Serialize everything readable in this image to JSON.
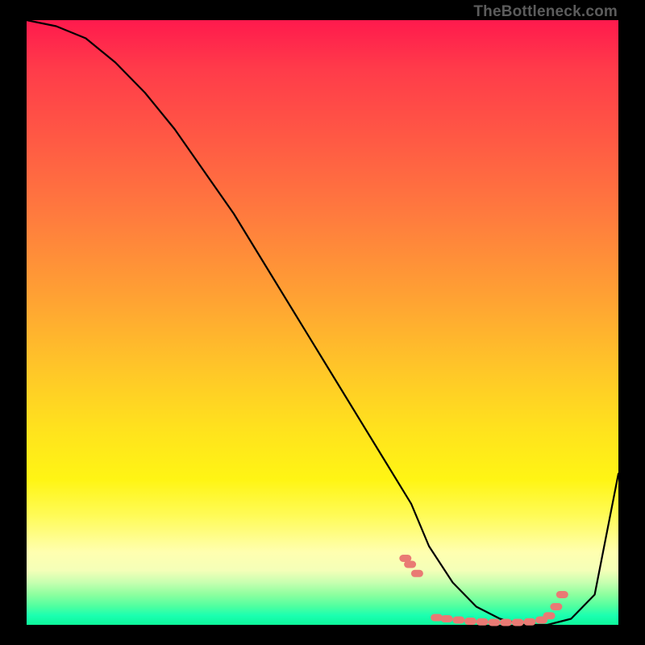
{
  "watermark": {
    "text": "TheBottleneck.com"
  },
  "chart_data": {
    "type": "line",
    "title": "",
    "xlabel": "",
    "ylabel": "",
    "xlim": [
      0,
      100
    ],
    "ylim": [
      0,
      100
    ],
    "background": "rainbow-vertical-gradient",
    "series": [
      {
        "name": "bottleneck-curve",
        "stroke": "#000000",
        "x": [
          0,
          5,
          10,
          15,
          20,
          25,
          30,
          35,
          40,
          45,
          50,
          55,
          60,
          65,
          68,
          72,
          76,
          80,
          84,
          88,
          92,
          96,
          100
        ],
        "values": [
          100,
          99,
          97,
          93,
          88,
          82,
          75,
          68,
          60,
          52,
          44,
          36,
          28,
          20,
          13,
          7,
          3,
          1,
          0,
          0,
          1,
          5,
          25
        ]
      }
    ],
    "markers": [
      {
        "name": "highlight-dots",
        "color": "#e97a74",
        "shape": "rounded-capsule",
        "points": [
          {
            "x": 64.0,
            "y": 11.0
          },
          {
            "x": 64.8,
            "y": 10.0
          },
          {
            "x": 66.0,
            "y": 8.5
          },
          {
            "x": 69.3,
            "y": 1.2
          },
          {
            "x": 71.0,
            "y": 1.0
          },
          {
            "x": 73.0,
            "y": 0.8
          },
          {
            "x": 75.0,
            "y": 0.6
          },
          {
            "x": 77.0,
            "y": 0.5
          },
          {
            "x": 79.0,
            "y": 0.4
          },
          {
            "x": 81.0,
            "y": 0.4
          },
          {
            "x": 83.0,
            "y": 0.4
          },
          {
            "x": 85.0,
            "y": 0.5
          },
          {
            "x": 87.0,
            "y": 0.8
          },
          {
            "x": 88.3,
            "y": 1.5
          },
          {
            "x": 89.5,
            "y": 3.0
          },
          {
            "x": 90.5,
            "y": 5.0
          }
        ]
      }
    ]
  }
}
